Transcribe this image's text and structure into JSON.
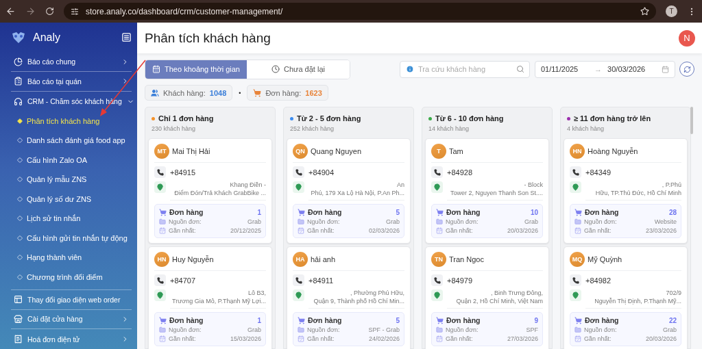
{
  "browser": {
    "url": "store.analy.co/dashboard/crm/customer-management/",
    "profile": "T"
  },
  "sidebar": {
    "brand": "Analy",
    "items": [
      {
        "label": "Báo cáo chung",
        "expanded": false
      },
      {
        "label": "Báo cáo tại quán",
        "expanded": false
      },
      {
        "label": "CRM - Chăm sóc khách hàng",
        "expanded": true,
        "children": [
          {
            "label": "Phân tích khách hàng",
            "selected": true
          },
          {
            "label": "Danh sách đánh giá food app",
            "selected": false
          },
          {
            "label": "Cấu hình Zalo OA",
            "selected": false
          },
          {
            "label": "Quản lý mẫu ZNS",
            "selected": false
          },
          {
            "label": "Quản lý số dư ZNS",
            "selected": false
          },
          {
            "label": "Lịch sử tin nhắn",
            "selected": false
          },
          {
            "label": "Cấu hình gửi tin nhắn tự động",
            "selected": false
          },
          {
            "label": "Hạng thành viên",
            "selected": false
          },
          {
            "label": "Chương trình đổi điểm",
            "selected": false
          }
        ]
      },
      {
        "label": "Thay đổi giao diện web order"
      },
      {
        "label": "Cài đặt cửa hàng",
        "expanded": false
      },
      {
        "label": "Hoá đơn điện tử",
        "expanded": false
      }
    ]
  },
  "header": {
    "title": "Phân tích khách hàng",
    "avatar": "N"
  },
  "tabs": [
    {
      "label": "Theo khoảng thời gian",
      "selected": true
    },
    {
      "label": "Chưa đặt lại",
      "selected": false
    }
  ],
  "search": {
    "placeholder": "Tra cứu khách hàng"
  },
  "date_range": {
    "start": "01/11/2025",
    "arrow": "→",
    "end": "30/03/2026"
  },
  "stats": [
    {
      "label": "Khách hàng:",
      "value": "1048",
      "color": "#3b7fd9"
    },
    {
      "label": "Đơn hàng:",
      "value": "1623",
      "color": "#e8843a"
    }
  ],
  "stats_separator": "•",
  "columns": [
    {
      "title": "Chỉ 1 đơn hàng",
      "count": "230 khách hàng",
      "color": "#f5922a",
      "customers": [
        {
          "initials": "MT",
          "name": "Mai Thị Hải",
          "phone": "+84915",
          "address": [
            "Khang Điền -",
            "Điểm Đón/Trả Khách GrabBike ..."
          ],
          "orders_label": "Đơn hàng",
          "orders": "1",
          "source_label": "Nguồn đơn:",
          "source": "Grab",
          "last_label": "Gần nhất:",
          "last": "20/12/2025"
        },
        {
          "initials": "HN",
          "name": "Huy Nguyễn",
          "phone": "+84707",
          "address": [
            "Lô B3,",
            "Trương Gia Mô, P.Thạnh Mỹ Lợi..."
          ],
          "orders_label": "Đơn hàng",
          "orders": "1",
          "source_label": "Nguồn đơn:",
          "source": "Grab",
          "last_label": "Gần nhất:",
          "last": "15/03/2026"
        }
      ]
    },
    {
      "title": "Từ 2 - 5 đơn hàng",
      "count": "252 khách hàng",
      "color": "#3b8cf0",
      "customers": [
        {
          "initials": "QN",
          "name": "Quang Nguyen",
          "phone": "+84904",
          "address": [
            "An",
            "Phú, 179 Xa Lộ Hà Nội, P.An Ph..."
          ],
          "orders_label": "Đơn hàng",
          "orders": "5",
          "source_label": "Nguồn đơn:",
          "source": "Grab",
          "last_label": "Gần nhất:",
          "last": "02/03/2026"
        },
        {
          "initials": "HA",
          "name": "hải anh",
          "phone": "+84911",
          "address": [
            ", Phường Phú Hữu,",
            "Quận 9, Thành phố Hồ Chí Min..."
          ],
          "orders_label": "Đơn hàng",
          "orders": "5",
          "source_label": "Nguồn đơn:",
          "source": "SPF - Grab",
          "last_label": "Gần nhất:",
          "last": "24/02/2026"
        }
      ]
    },
    {
      "title": "Từ 6 - 10 đơn hàng",
      "count": "14 khách hàng",
      "color": "#3cab4a",
      "customers": [
        {
          "initials": "T",
          "name": "Tam",
          "phone": "+84928",
          "address": [
            "- Block",
            "Tower 2, Nguyen Thanh Son St...."
          ],
          "orders_label": "Đơn hàng",
          "orders": "10",
          "source_label": "Nguồn đơn:",
          "source": "Grab",
          "last_label": "Gần nhất:",
          "last": "20/03/2026"
        },
        {
          "initials": "TN",
          "name": "Tran Ngoc",
          "phone": "+84979",
          "address": [
            ", Binh Trưng Đông,",
            "Quận 2, Hồ Chí Minh, Việt Nam"
          ],
          "orders_label": "Đơn hàng",
          "orders": "9",
          "source_label": "Nguồn đơn:",
          "source": "SPF",
          "last_label": "Gần nhất:",
          "last": "27/03/2026"
        }
      ]
    },
    {
      "title": "≥ 11 đơn hàng trở lên",
      "count": "4 khách hàng",
      "color": "#9b2fae",
      "customers": [
        {
          "initials": "HN",
          "name": "Hoàng Nguyễn",
          "phone": "+84349",
          "address": [
            ", P.Phú",
            "Hữu, TP.Thủ Đức, Hồ Chí Minh"
          ],
          "orders_label": "Đơn hàng",
          "orders": "28",
          "source_label": "Nguồn đơn:",
          "source": "Website",
          "last_label": "Gần nhất:",
          "last": "23/03/2026"
        },
        {
          "initials": "MQ",
          "name": "Mỹ Quỳnh",
          "phone": "+84982",
          "address": [
            "702/9",
            "Nguyễn Thị Định, P.Thạnh Mỹ..."
          ],
          "orders_label": "Đơn hàng",
          "orders": "22",
          "source_label": "Nguồn đơn:",
          "source": "Grab",
          "last_label": "Gần nhất:",
          "last": "20/03/2026"
        }
      ]
    }
  ]
}
